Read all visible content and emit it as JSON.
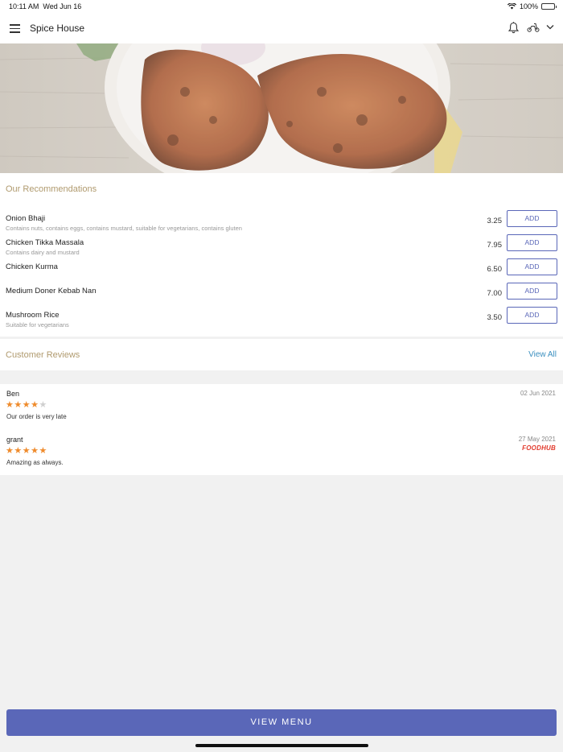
{
  "status_bar": {
    "time": "10:11 AM",
    "date": "Wed Jun 16",
    "battery": "100%"
  },
  "header": {
    "title": "Spice House"
  },
  "recommendations": {
    "title": "Our Recommendations",
    "items": [
      {
        "name": "Onion Bhaji",
        "description": "Contains nuts, contains eggs, contains mustard, suitable for vegetarians, contains gluten",
        "price": "3.25",
        "button": "ADD"
      },
      {
        "name": "Chicken Tikka Massala",
        "description": "Contains dairy and mustard",
        "price": "7.95",
        "button": "ADD"
      },
      {
        "name": "Chicken Kurma",
        "description": "",
        "price": "6.50",
        "button": "ADD"
      },
      {
        "name": "Medium Doner Kebab Nan",
        "description": "",
        "price": "7.00",
        "button": "ADD"
      },
      {
        "name": "Mushroom Rice",
        "description": "Suitable for vegetarians",
        "price": "3.50",
        "button": "ADD"
      }
    ]
  },
  "reviews": {
    "title": "Customer Reviews",
    "view_all": "View All",
    "items": [
      {
        "name": "Ben",
        "date": "02 Jun 2021",
        "rating": 4,
        "text": "Our order is very late",
        "source": ""
      },
      {
        "name": "grant",
        "date": "27 May 2021",
        "rating": 5,
        "text": "Amazing as always.",
        "source": "FOODHUB"
      }
    ]
  },
  "view_menu_label": "VIEW MENU",
  "colors": {
    "accent": "#5a67b8",
    "section_title": "#b09a6e",
    "link": "#3a8fbf",
    "star": "#ef8b2c",
    "foodhub": "#e23b2d"
  }
}
